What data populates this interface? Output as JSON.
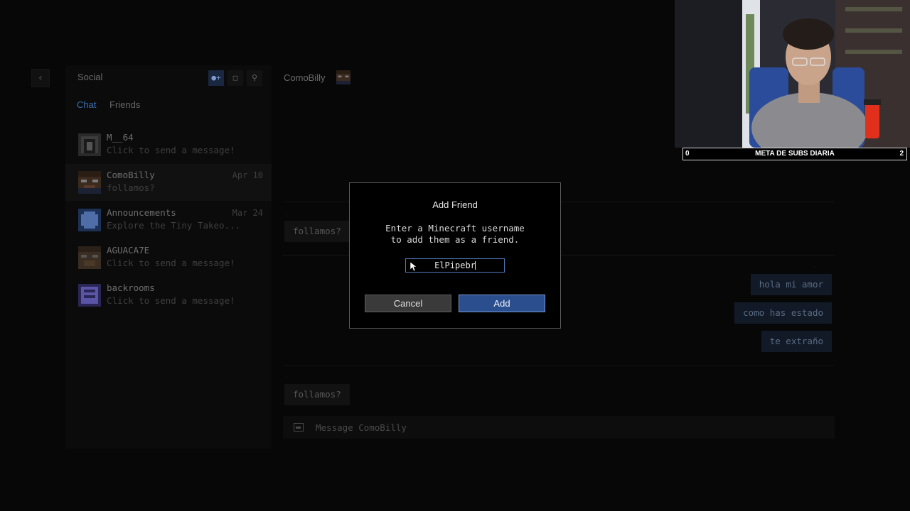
{
  "sidebar": {
    "title": "Social",
    "tabs": [
      {
        "label": "Chat"
      },
      {
        "label": "Friends"
      }
    ],
    "conversations": [
      {
        "name": "M__64",
        "preview": "Click to send a message!",
        "date": ""
      },
      {
        "name": "ComoBilly",
        "preview": "follamos?",
        "date": "Apr 10"
      },
      {
        "name": "Announcements",
        "preview": "Explore the Tiny Takeo...",
        "date": "Mar 24"
      },
      {
        "name": "AGUACA7E",
        "preview": "Click to send a message!",
        "date": ""
      },
      {
        "name": "backrooms",
        "preview": "Click to send a message!",
        "date": ""
      }
    ]
  },
  "chat": {
    "contact_name": "ComoBilly",
    "messages": [
      {
        "text": "follamos?",
        "direction": "in"
      },
      {
        "text": "hola mi amor",
        "direction": "out"
      },
      {
        "text": "como has estado",
        "direction": "out"
      },
      {
        "text": "te extraño",
        "direction": "out"
      },
      {
        "text": "follamos?",
        "direction": "in"
      }
    ],
    "composer_placeholder": "Message ComoBilly"
  },
  "dialog": {
    "title": "Add Friend",
    "description_line1": "Enter a Minecraft username",
    "description_line2": "to add them as a friend.",
    "input_value": "ElPipebr",
    "cancel_label": "Cancel",
    "add_label": "Add"
  },
  "overlay": {
    "subs_current": "0",
    "subs_label": "META DE SUBS DIARIA",
    "subs_goal": "2"
  },
  "colors": {
    "accent": "#2b4f8e",
    "tab_active": "#3b6fb5",
    "background": "#070707"
  }
}
